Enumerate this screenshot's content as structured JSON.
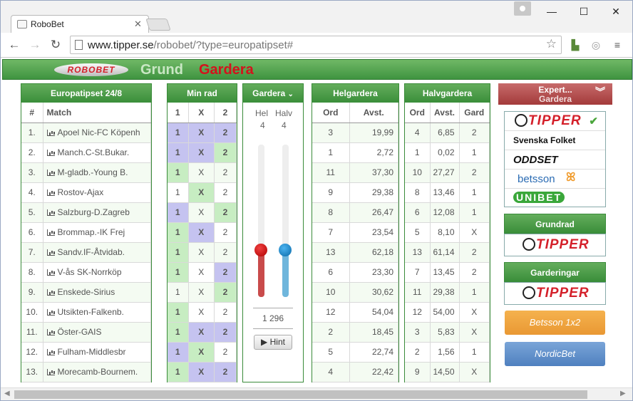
{
  "browser": {
    "tab_title": "RoboBet",
    "url_host": "www.tipper.se",
    "url_path": "/robobet/?type=europatipset#"
  },
  "site": {
    "logo": "ROBOBET",
    "menu": [
      "Grund",
      "Gardera"
    ]
  },
  "match_panel": {
    "title": "Europatipset 24/8",
    "col_num": "#",
    "col_match": "Match",
    "matches": [
      "Apoel Nic-FC Köpenh",
      "Manch.C-St.Bukar.",
      "M-gladb.-Young B.",
      "Rostov-Ajax",
      "Salzburg-D.Zagreb",
      "Brommap.-IK Frej",
      "Sandv.IF-Åtvidab.",
      "V-ås SK-Norrköp",
      "Enskede-Sirius",
      "Utsikten-Falkenb.",
      "Öster-GAIS",
      "Fulham-Middlesbr",
      "Morecamb-Bournem."
    ]
  },
  "min_rad": {
    "title": "Min rad",
    "cols": [
      "1",
      "X",
      "2"
    ],
    "rows": [
      [
        "p",
        "p",
        "p"
      ],
      [
        "p",
        "p",
        "g"
      ],
      [
        "g",
        "f",
        "f"
      ],
      [
        "f",
        "g",
        "f"
      ],
      [
        "p",
        "f",
        "g"
      ],
      [
        "g",
        "p",
        "f"
      ],
      [
        "g",
        "f",
        "f"
      ],
      [
        "g",
        "f",
        "p"
      ],
      [
        "f",
        "f",
        "g"
      ],
      [
        "g",
        "f",
        "f"
      ],
      [
        "g",
        "p",
        "p"
      ],
      [
        "p",
        "g",
        "f"
      ],
      [
        "g",
        "p",
        "p"
      ]
    ]
  },
  "gardera": {
    "title": "Gardera",
    "hel_label": "Hel",
    "halv_label": "Halv",
    "hel_value": "4",
    "halv_value": "4",
    "rows_count": "1 296",
    "hint": "Hint"
  },
  "helgardera": {
    "title": "Helgardera",
    "col_ord": "Ord",
    "col_avst": "Avst.",
    "rows": [
      [
        "3",
        "19,99"
      ],
      [
        "1",
        "2,72"
      ],
      [
        "11",
        "37,30"
      ],
      [
        "9",
        "29,38"
      ],
      [
        "8",
        "26,47"
      ],
      [
        "7",
        "23,54"
      ],
      [
        "13",
        "62,18"
      ],
      [
        "6",
        "23,30"
      ],
      [
        "10",
        "30,62"
      ],
      [
        "12",
        "54,04"
      ],
      [
        "2",
        "18,45"
      ],
      [
        "5",
        "22,74"
      ],
      [
        "4",
        "22,42"
      ]
    ]
  },
  "halvgardera": {
    "title": "Halvgardera",
    "col_ord": "Ord",
    "col_avst": "Avst.",
    "col_gard": "Gard",
    "rows": [
      [
        "4",
        "6,85",
        "2"
      ],
      [
        "1",
        "0,02",
        "1"
      ],
      [
        "10",
        "27,27",
        "2"
      ],
      [
        "8",
        "13,46",
        "1"
      ],
      [
        "6",
        "12,08",
        "1"
      ],
      [
        "5",
        "8,10",
        "X"
      ],
      [
        "13",
        "61,14",
        "2"
      ],
      [
        "7",
        "13,45",
        "2"
      ],
      [
        "11",
        "29,38",
        "1"
      ],
      [
        "12",
        "54,00",
        "X"
      ],
      [
        "3",
        "5,83",
        "X"
      ],
      [
        "2",
        "1,56",
        "1"
      ],
      [
        "9",
        "14,50",
        "X"
      ]
    ]
  },
  "side": {
    "expert": "Expert...",
    "expert_sub": "Gardera",
    "brands": [
      "TIPPER",
      "Svenska Folket",
      "ODDSET",
      "betsson",
      "UNIBET"
    ],
    "grundrad": "Grundrad",
    "garderingar": "Garderingar",
    "tipper": "TIPPER",
    "betsson_btn": "Betsson 1x2",
    "nordicbet_btn": "NordicBet"
  }
}
